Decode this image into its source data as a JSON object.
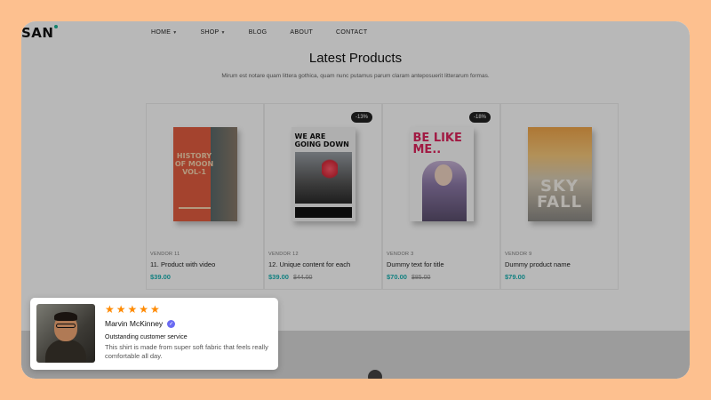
{
  "site": {
    "logo": "SAN",
    "nav": [
      {
        "label": "HOME",
        "has_dropdown": true
      },
      {
        "label": "SHOP",
        "has_dropdown": true
      },
      {
        "label": "BLOG",
        "has_dropdown": false
      },
      {
        "label": "ABOUT",
        "has_dropdown": false
      },
      {
        "label": "CONTACT",
        "has_dropdown": false
      }
    ],
    "heading": "Latest Products",
    "subheading": "Mirum est notare quam littera gothica, quam nunc putamus parum claram anteposuerit litterarum formas."
  },
  "products": [
    {
      "vendor": "VENDOR 11",
      "name": "11. Product with video",
      "price": "$39.00",
      "old_price": "",
      "badge": "",
      "cover_text": "HISTORY OF MOON VOL-1"
    },
    {
      "vendor": "VENDOR 12",
      "name": "12. Unique content for each",
      "price": "$39.00",
      "old_price": "$44.00",
      "badge": "-13%",
      "cover_text": "WE ARE GOING DOWN"
    },
    {
      "vendor": "VENDOR 3",
      "name": "Dummy text for title",
      "price": "$70.00",
      "old_price": "$85.00",
      "badge": "-18%",
      "cover_text": "BE LIKE ME.."
    },
    {
      "vendor": "VENDOR 9",
      "name": "Dummy product name",
      "price": "$79.00",
      "old_price": "",
      "badge": "",
      "cover_text": "SKY FALL"
    }
  ],
  "review": {
    "rating": 5,
    "stars": "★★★★★",
    "name": "Marvin McKinney",
    "title": "Outstanding customer service",
    "body": "This shirt is made from super soft fabric that feels really comfortable all day."
  },
  "colors": {
    "page_bg": "#fdc08f",
    "star": "#ff8a00",
    "price": "#1ab3b3",
    "verified": "#6b6bf2"
  }
}
